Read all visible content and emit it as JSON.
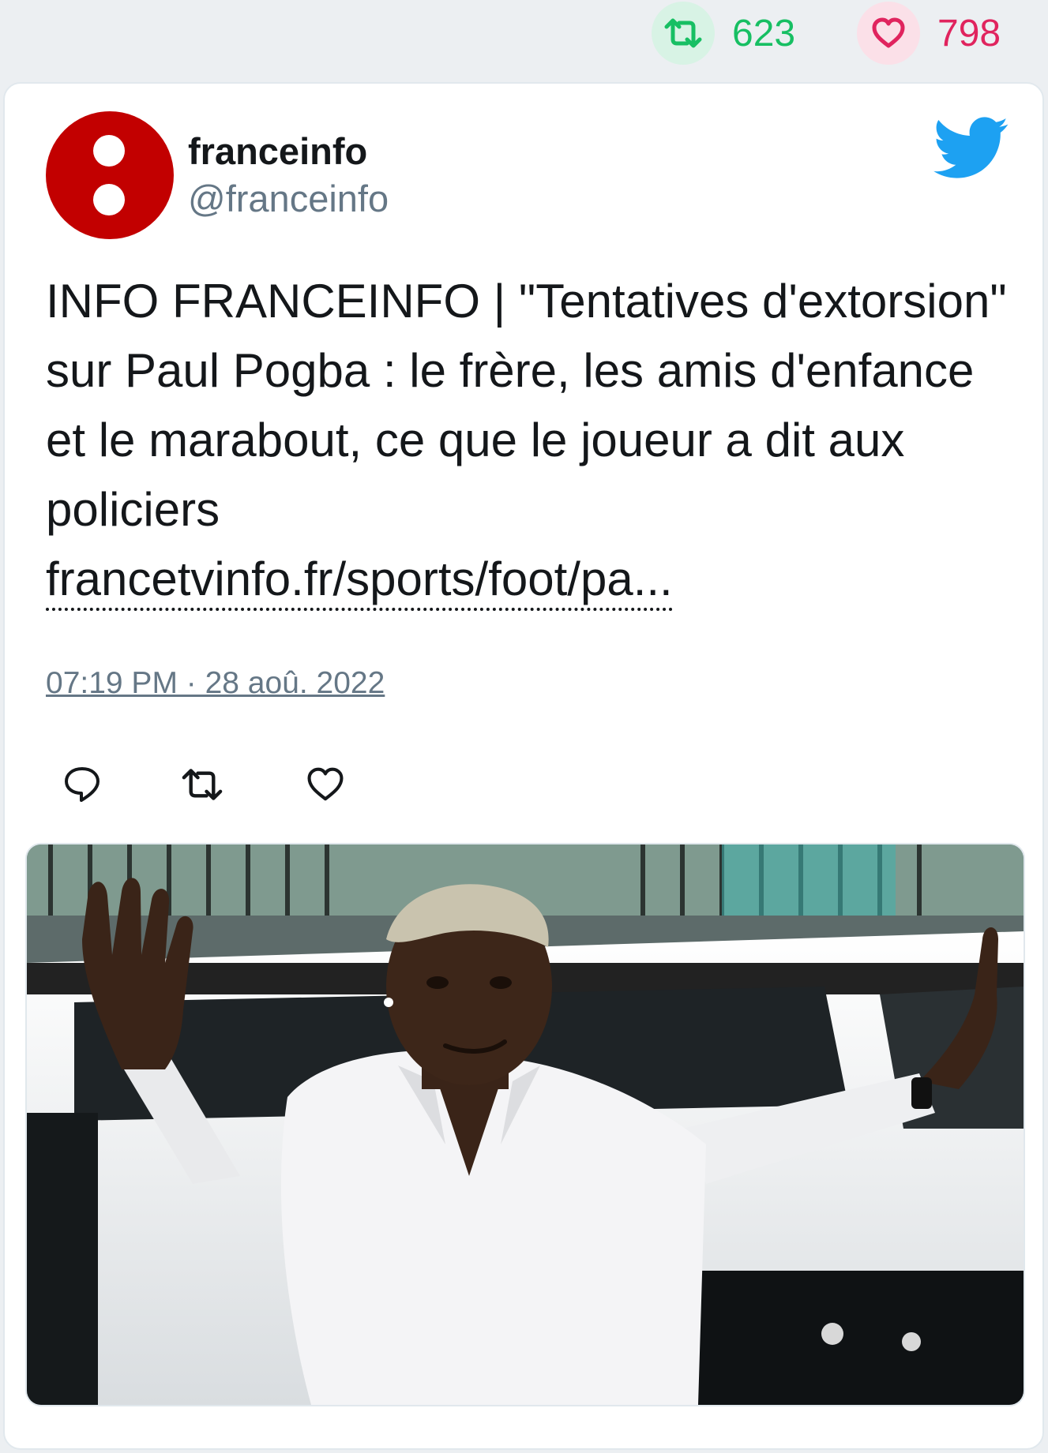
{
  "stats": {
    "retweet_count": "623",
    "like_count": "798"
  },
  "tweet": {
    "display_name": "franceinfo",
    "handle": "@franceinfo",
    "text": "INFO FRANCEINFO | \"Tentatives d'extorsion\" sur Paul Pogba : le frère, les amis d'enfance et le marabout, ce que le joueur a dit aux policiers",
    "link": "francetvinfo.fr/sports/foot/pa...",
    "timestamp": "07:19 PM · 28 aoû. 2022"
  },
  "icons": {
    "retweet_stat": "retweet-icon",
    "like_stat": "heart-icon",
    "brand": "twitter-bird-icon",
    "reply": "reply-icon",
    "retweet": "retweet-icon",
    "like": "heart-icon"
  },
  "colors": {
    "retweet_green": "#17bf63",
    "like_red": "#e0245e",
    "twitter_blue": "#1da1f2",
    "avatar_red": "#c20000",
    "secondary_text": "#657786"
  }
}
